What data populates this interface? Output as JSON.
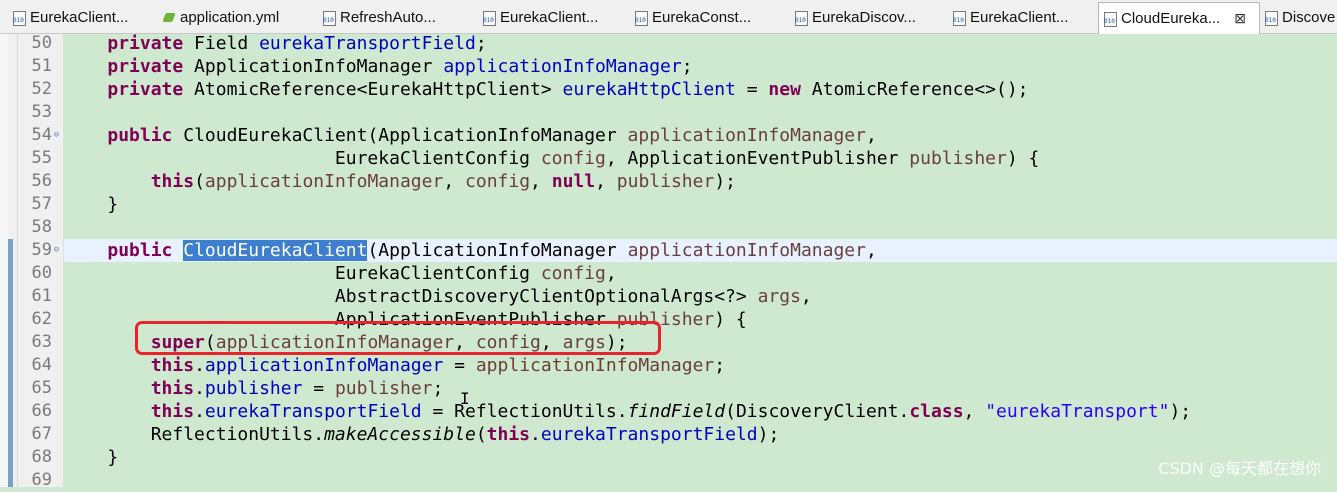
{
  "tabs": [
    {
      "label": "EurekaClient...",
      "icon": "java-class-file-icon",
      "active": false
    },
    {
      "label": "application.yml",
      "icon": "yaml-file-icon",
      "active": false
    },
    {
      "label": "RefreshAuto...",
      "icon": "java-class-file-icon",
      "active": false
    },
    {
      "label": "EurekaClient...",
      "icon": "java-class-file-icon",
      "active": false
    },
    {
      "label": "EurekaConst...",
      "icon": "java-class-file-icon",
      "active": false
    },
    {
      "label": "EurekaDiscov...",
      "icon": "java-class-file-icon",
      "active": false
    },
    {
      "label": "EurekaClient...",
      "icon": "java-class-file-icon",
      "active": false
    },
    {
      "label": "CloudEureka...",
      "icon": "java-class-file-icon",
      "active": true,
      "close_glyph": "⊠"
    },
    {
      "label": "Discove",
      "icon": "java-class-file-icon",
      "active": false
    }
  ],
  "editor": {
    "lines": [
      {
        "num": "50",
        "code": [
          [
            "    ",
            ""
          ],
          [
            "private",
            "kw"
          ],
          [
            " Field ",
            ""
          ],
          [
            "eurekaTransportField",
            "fld"
          ],
          [
            ";",
            ""
          ]
        ]
      },
      {
        "num": "51",
        "code": [
          [
            "    ",
            ""
          ],
          [
            "private",
            "kw"
          ],
          [
            " ApplicationInfoManager ",
            ""
          ],
          [
            "applicationInfoManager",
            "fld"
          ],
          [
            ";",
            ""
          ]
        ]
      },
      {
        "num": "52",
        "code": [
          [
            "    ",
            ""
          ],
          [
            "private",
            "kw"
          ],
          [
            " AtomicReference<EurekaHttpClient> ",
            ""
          ],
          [
            "eurekaHttpClient",
            "fld"
          ],
          [
            " = ",
            ""
          ],
          [
            "new",
            "kw"
          ],
          [
            " AtomicReference<>();",
            ""
          ]
        ]
      },
      {
        "num": "53",
        "code": []
      },
      {
        "num": "54",
        "fold": "⊖",
        "code": [
          [
            "    ",
            ""
          ],
          [
            "public",
            "kw"
          ],
          [
            " CloudEurekaClient(ApplicationInfoManager ",
            ""
          ],
          [
            "applicationInfoManager",
            "param"
          ],
          [
            ",",
            ""
          ]
        ]
      },
      {
        "num": "55",
        "code": [
          [
            "                         EurekaClientConfig ",
            ""
          ],
          [
            "config",
            "param"
          ],
          [
            ", ApplicationEventPublisher ",
            ""
          ],
          [
            "publisher",
            "param"
          ],
          [
            ") {",
            ""
          ]
        ]
      },
      {
        "num": "56",
        "code": [
          [
            "        ",
            ""
          ],
          [
            "this",
            "kw"
          ],
          [
            "(",
            ""
          ],
          [
            "applicationInfoManager",
            "param"
          ],
          [
            ", ",
            ""
          ],
          [
            "config",
            "param"
          ],
          [
            ", ",
            ""
          ],
          [
            "null",
            "kw"
          ],
          [
            ", ",
            ""
          ],
          [
            "publisher",
            "param"
          ],
          [
            ");",
            ""
          ]
        ]
      },
      {
        "num": "57",
        "code": [
          [
            "    }",
            ""
          ]
        ]
      },
      {
        "num": "58",
        "code": []
      },
      {
        "num": "59",
        "fold": "⊖",
        "current": true,
        "code": [
          [
            "    ",
            ""
          ],
          [
            "public",
            "kw"
          ],
          [
            " ",
            ""
          ],
          [
            "CloudEurekaClient",
            "sel"
          ],
          [
            "(ApplicationInfoManager ",
            ""
          ],
          [
            "applicationInfoManager",
            "param"
          ],
          [
            ",",
            ""
          ]
        ]
      },
      {
        "num": "60",
        "code": [
          [
            "                         EurekaClientConfig ",
            ""
          ],
          [
            "config",
            "param"
          ],
          [
            ",",
            ""
          ]
        ]
      },
      {
        "num": "61",
        "code": [
          [
            "                         AbstractDiscoveryClientOptionalArgs<?> ",
            ""
          ],
          [
            "args",
            "param"
          ],
          [
            ",",
            ""
          ]
        ]
      },
      {
        "num": "62",
        "code": [
          [
            "                         ApplicationEventPublisher ",
            ""
          ],
          [
            "publisher",
            "param"
          ],
          [
            ") {",
            ""
          ]
        ]
      },
      {
        "num": "63",
        "code": [
          [
            "        ",
            ""
          ],
          [
            "super",
            "kw"
          ],
          [
            "(",
            ""
          ],
          [
            "applicationInfoManager",
            "param"
          ],
          [
            ", ",
            ""
          ],
          [
            "config",
            "param"
          ],
          [
            ", ",
            ""
          ],
          [
            "args",
            "param"
          ],
          [
            ");",
            ""
          ]
        ]
      },
      {
        "num": "64",
        "code": [
          [
            "        ",
            ""
          ],
          [
            "this",
            "kw"
          ],
          [
            ".",
            ""
          ],
          [
            "applicationInfoManager",
            "fld"
          ],
          [
            " = ",
            ""
          ],
          [
            "applicationInfoManager",
            "param"
          ],
          [
            ";",
            ""
          ]
        ]
      },
      {
        "num": "65",
        "code": [
          [
            "        ",
            ""
          ],
          [
            "this",
            "kw"
          ],
          [
            ".",
            ""
          ],
          [
            "publisher",
            "fld"
          ],
          [
            " = ",
            ""
          ],
          [
            "publisher",
            "param"
          ],
          [
            ";",
            ""
          ]
        ]
      },
      {
        "num": "66",
        "code": [
          [
            "        ",
            ""
          ],
          [
            "this",
            "kw"
          ],
          [
            ".",
            ""
          ],
          [
            "eurekaTransportField",
            "fld"
          ],
          [
            " = ReflectionUtils.",
            ""
          ],
          [
            "findField",
            "it"
          ],
          [
            "(DiscoveryClient.",
            ""
          ],
          [
            "class",
            "kw"
          ],
          [
            ", ",
            ""
          ],
          [
            "\"eurekaTransport\"",
            "str"
          ],
          [
            ");",
            ""
          ]
        ]
      },
      {
        "num": "67",
        "code": [
          [
            "        ReflectionUtils.",
            ""
          ],
          [
            "makeAccessible",
            "it"
          ],
          [
            "(",
            ""
          ],
          [
            "this",
            "kw"
          ],
          [
            ".",
            ""
          ],
          [
            "eurekaTransportField",
            "fld"
          ],
          [
            ");",
            ""
          ]
        ]
      },
      {
        "num": "68",
        "code": [
          [
            "    }",
            ""
          ]
        ]
      },
      {
        "num": "69",
        "code": []
      }
    ]
  },
  "colors": {
    "editor_bg": "#cfe9d0",
    "keyword": "#7f0055",
    "field": "#0000c0",
    "parameter": "#6a3e3e",
    "string": "#2a00ff",
    "selection": "#3d7ecf",
    "highlight_box": "#e8232b"
  },
  "cursor_glyph": "I",
  "watermark": "CSDN @每天都在想你"
}
